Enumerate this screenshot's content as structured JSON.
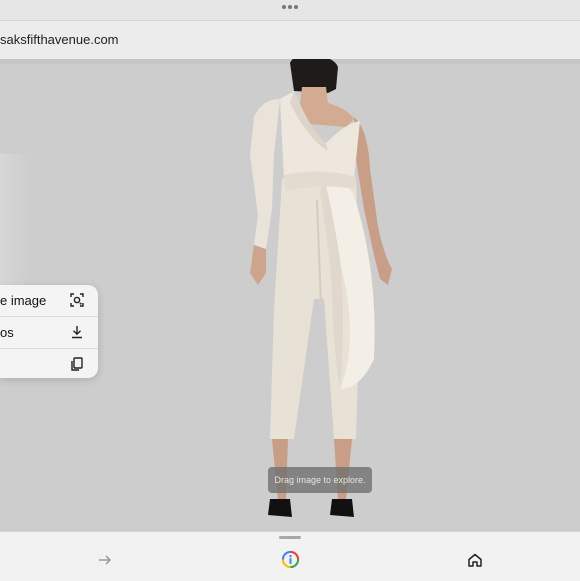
{
  "browser": {
    "url": "saksfifthavenue.com",
    "top_dots_icon": "more-horizontal-icon"
  },
  "viewer": {
    "drag_hint": "Drag image to explore."
  },
  "context_menu": {
    "items": [
      {
        "label": "e image",
        "icon": "lens-search-icon"
      },
      {
        "label": "os",
        "icon": "download-icon"
      },
      {
        "label": "",
        "icon": "copy-icon"
      }
    ]
  },
  "bottom_nav": {
    "items": [
      {
        "icon": "forward-arrow-icon",
        "enabled": false
      },
      {
        "icon": "google-lens-icon",
        "enabled": true
      },
      {
        "icon": "home-icon",
        "enabled": true
      }
    ]
  },
  "colors": {
    "background": "#cbcbcb",
    "garment": "#ece6dc",
    "toolbar": "#f2f2f2"
  }
}
